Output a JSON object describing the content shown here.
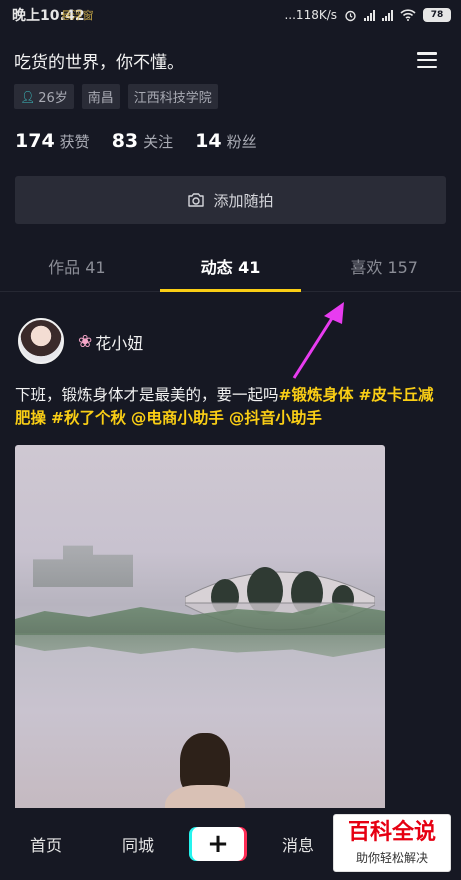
{
  "status_bar": {
    "time": "晚上10:42",
    "overlay_text": "悬浮窗",
    "network_speed": "...118K/s",
    "battery": "78"
  },
  "profile": {
    "name": "吃货的世界，你不懂。",
    "tags": [
      "26岁",
      "南昌",
      "江西科技学院"
    ],
    "stats": [
      {
        "num": "174",
        "label": "获赞"
      },
      {
        "num": "83",
        "label": "关注"
      },
      {
        "num": "14",
        "label": "粉丝"
      }
    ],
    "add_button_label": "添加随拍"
  },
  "tabs": [
    {
      "label": "作品 41",
      "active": false
    },
    {
      "label": "动态 41",
      "active": true
    },
    {
      "label": "喜欢 157",
      "active": false
    }
  ],
  "post": {
    "author": "花小妞",
    "text_plain": "下班，锻炼身体才是最美的，要一起吗",
    "hashtags": [
      "#锻炼身体",
      "#皮卡丘减肥操",
      "#秋了个秋",
      "@电商小助手",
      "@抖音小助手"
    ]
  },
  "bottom_nav": {
    "home": "首页",
    "nearby": "同城",
    "plus": "+",
    "messages": "消息"
  },
  "watermark": {
    "main": "百科全说",
    "sub": "助你轻松解决"
  },
  "colors": {
    "background": "#161823",
    "accent_yellow": "#face15",
    "arrow_magenta": "#e83cf0"
  }
}
